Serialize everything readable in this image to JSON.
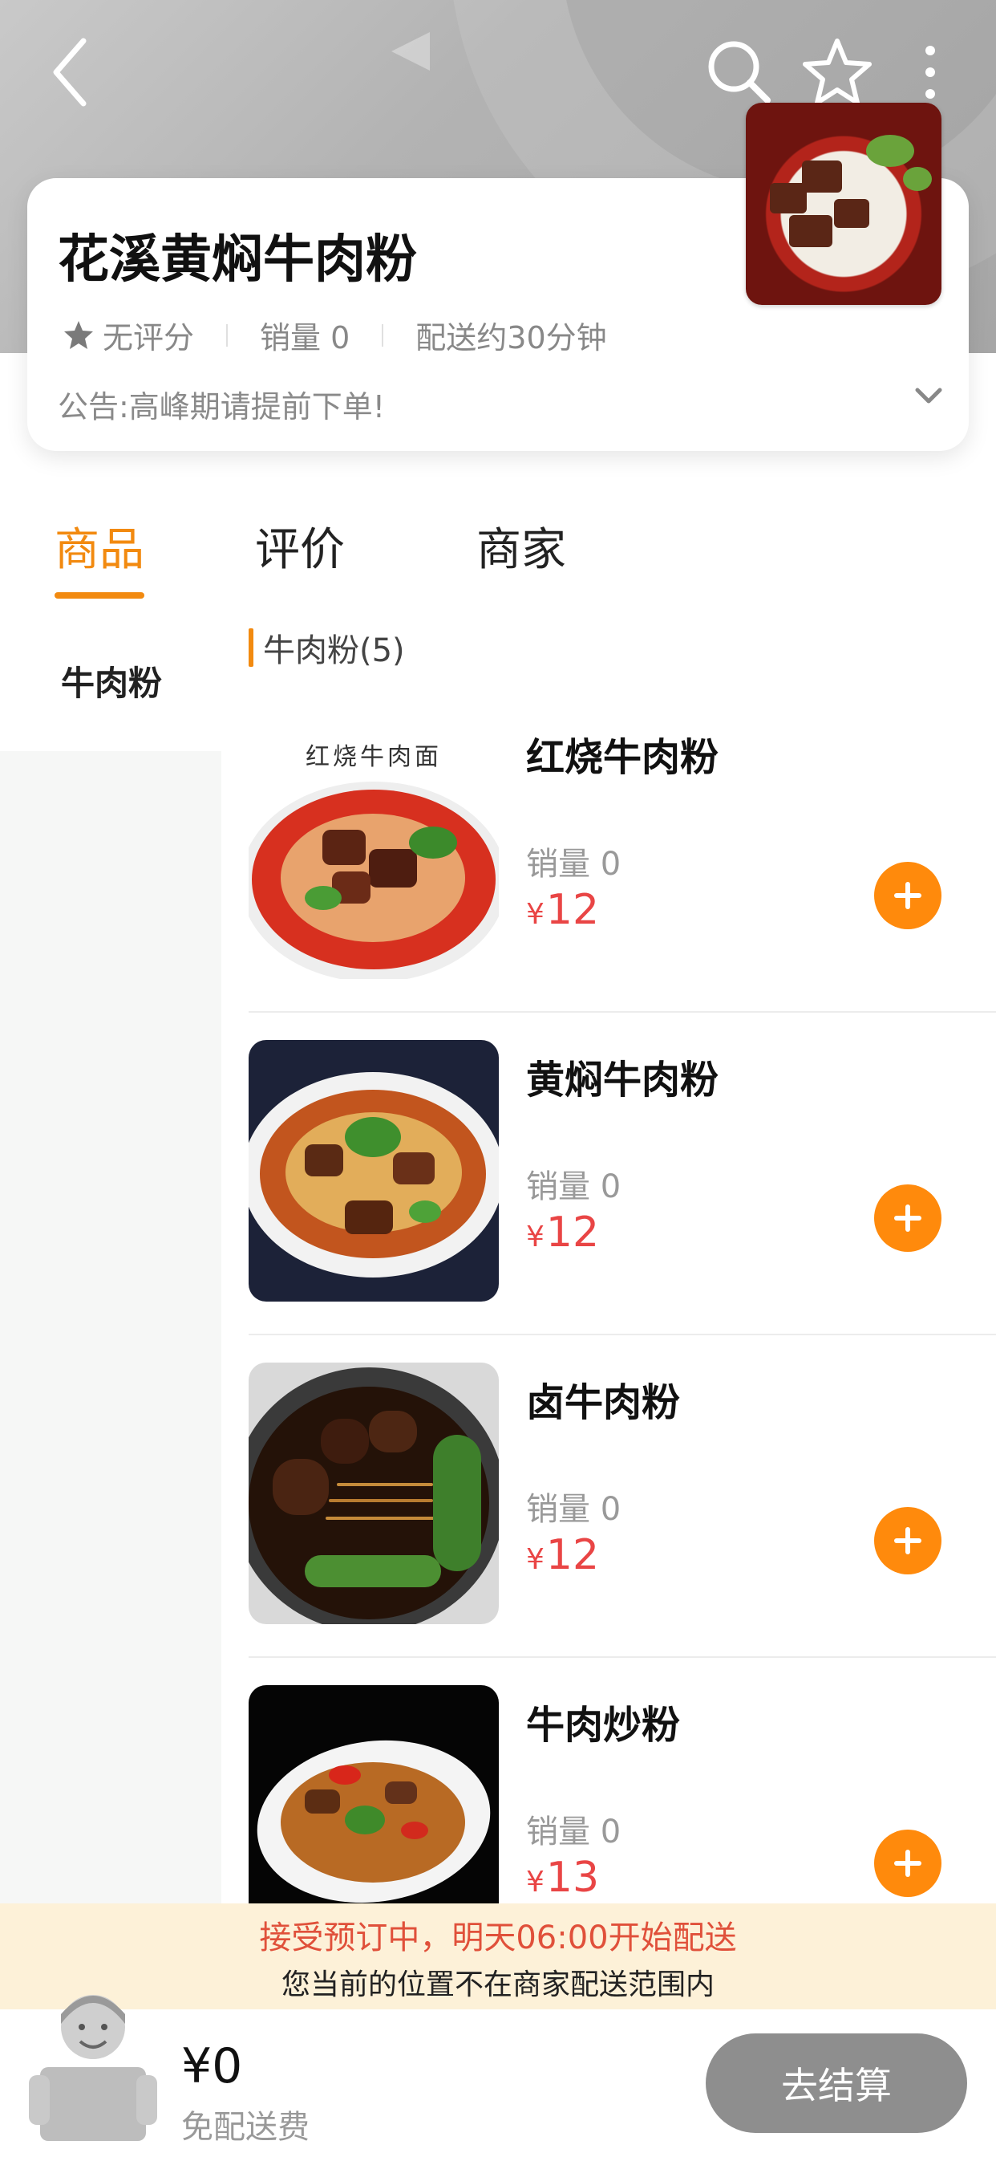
{
  "header": {
    "icons": [
      "back-icon",
      "search-icon",
      "star-outline-icon",
      "more-vertical-icon"
    ]
  },
  "shop": {
    "name": "花溪黄焖牛肉粉",
    "rating": "无评分",
    "sales": "销量 0",
    "delivery_time": "配送约30分钟",
    "notice": "公告:高峰期请提前下单!"
  },
  "tabs": [
    {
      "label": "商品",
      "active": true
    },
    {
      "label": "评价",
      "active": false
    },
    {
      "label": "商家",
      "active": false
    }
  ],
  "sidebar": {
    "categories": [
      {
        "label": "牛肉粉",
        "active": true
      }
    ]
  },
  "list": {
    "category_header": "牛肉粉(5)",
    "products": [
      {
        "name": "红烧牛肉粉",
        "sales": "销量 0",
        "currency": "¥",
        "price": "12",
        "image_caption": "红烧牛肉面"
      },
      {
        "name": "黄焖牛肉粉",
        "sales": "销量 0",
        "currency": "¥",
        "price": "12"
      },
      {
        "name": "卤牛肉粉",
        "sales": "销量 0",
        "currency": "¥",
        "price": "12"
      },
      {
        "name": "牛肉炒粉",
        "sales": "销量 0",
        "currency": "¥",
        "price": "13"
      }
    ]
  },
  "banner": {
    "line1": "接受预订中，明天06:00开始配送",
    "line2": "您当前的位置不在商家配送范围内"
  },
  "cart": {
    "total": "¥0",
    "delivery_fee": "免配送费",
    "checkout_label": "去结算"
  },
  "colors": {
    "accent": "#f28a10",
    "add_button": "#ff8a0c",
    "price": "#e94545",
    "checkout_disabled": "#8e8e8e",
    "banner_bg": "#fdf1d8"
  }
}
